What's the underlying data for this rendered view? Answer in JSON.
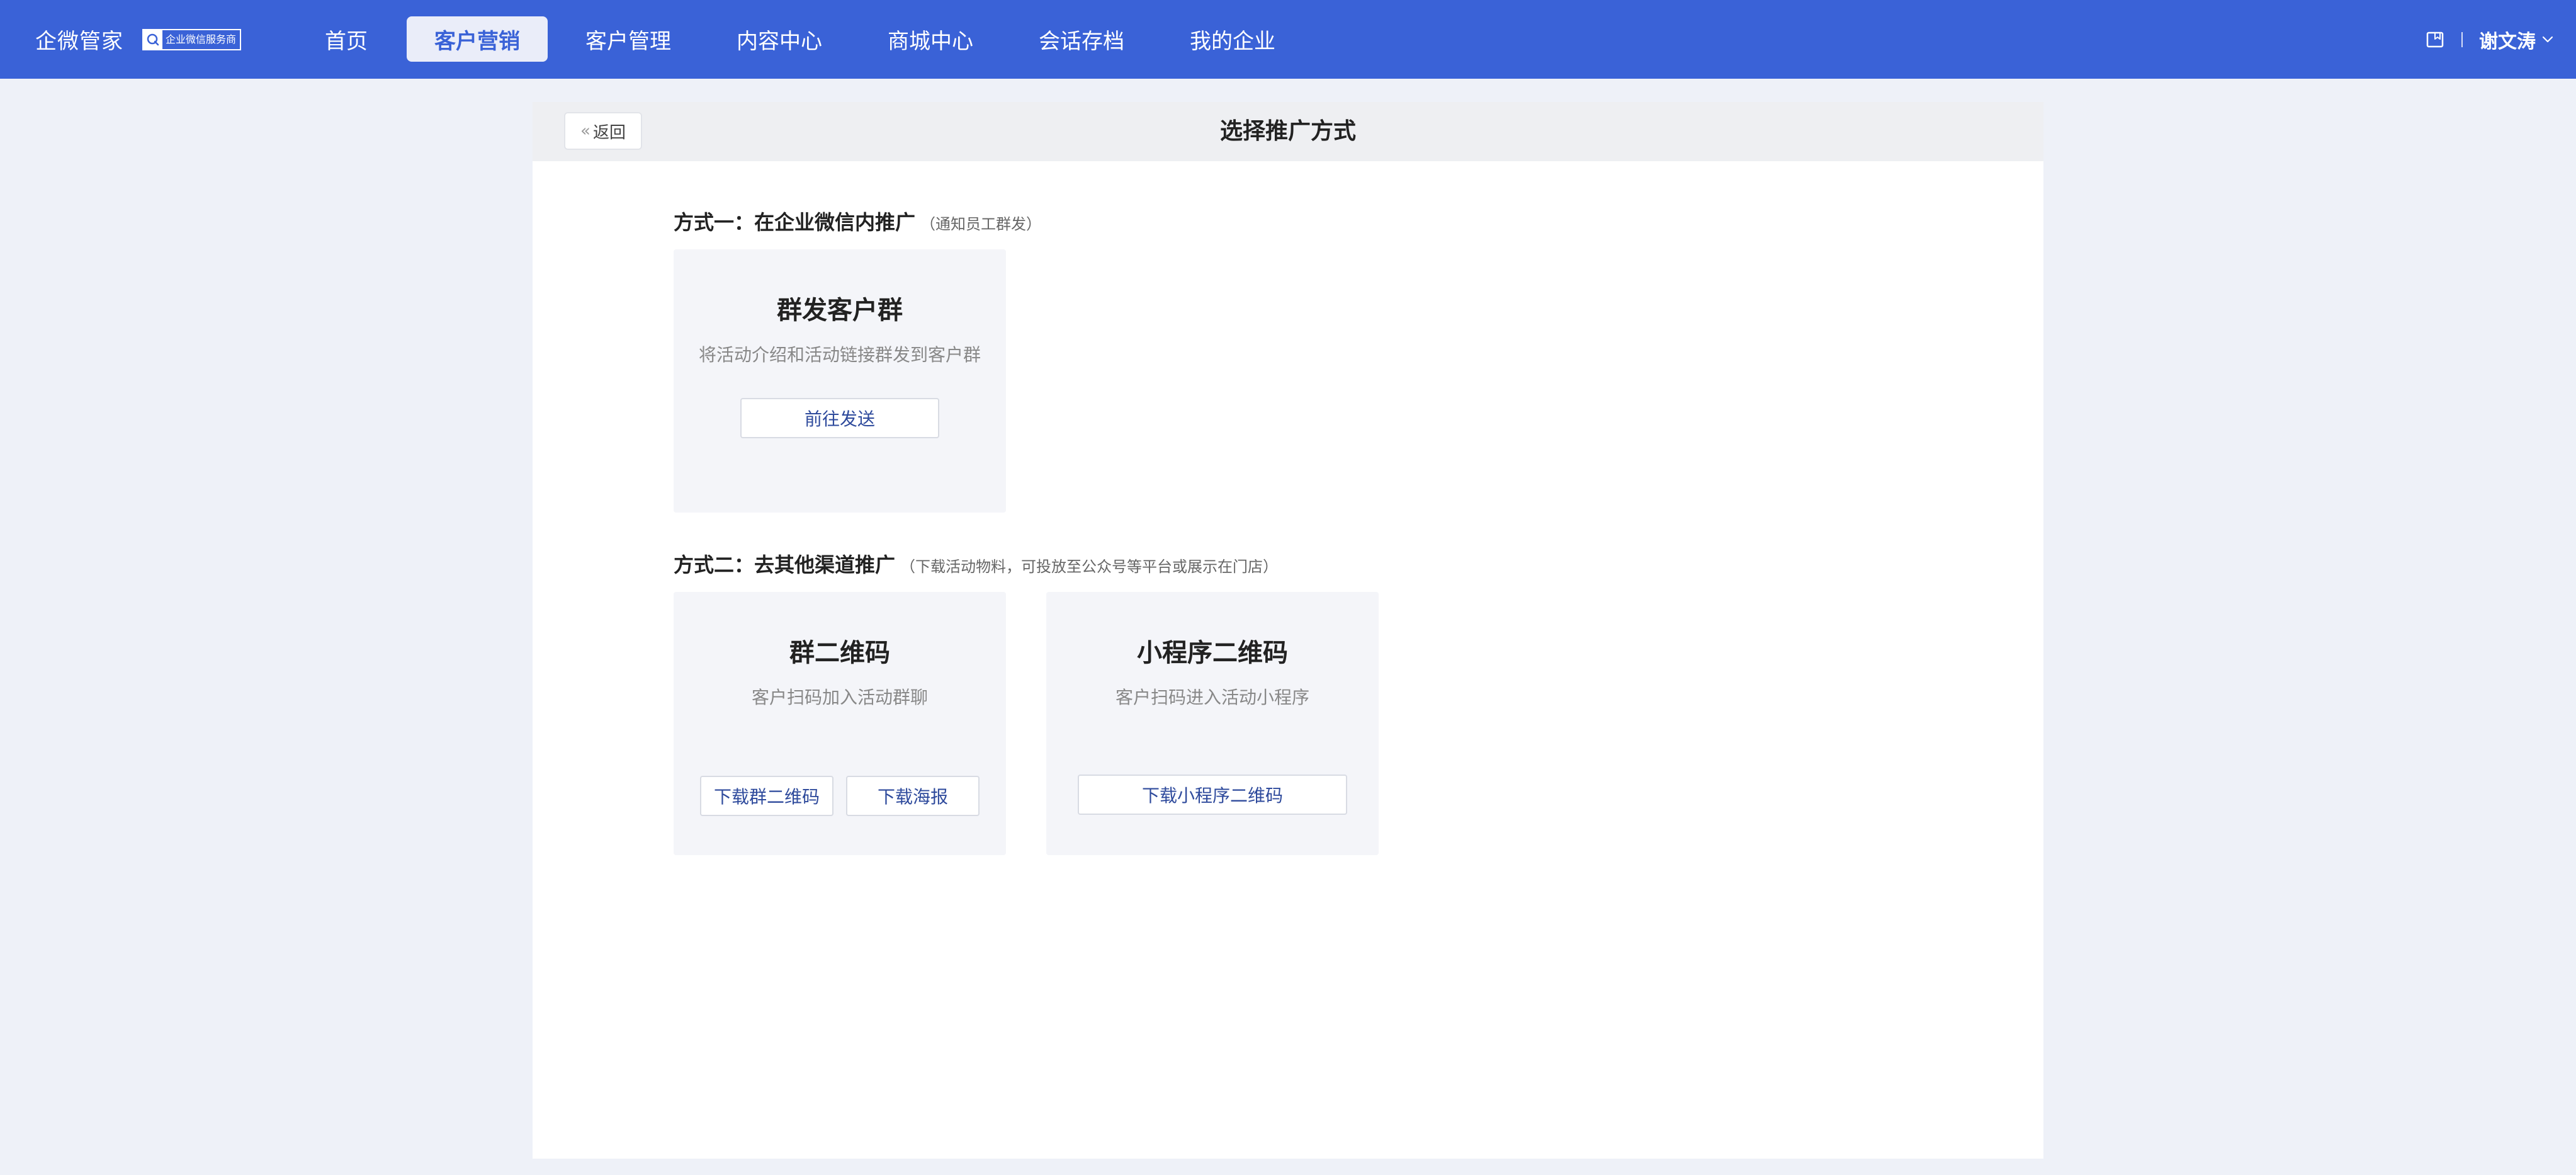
{
  "header": {
    "brand_name": "企微管家",
    "badge_text": "企业微信服务商",
    "nav": [
      {
        "label": "首页"
      },
      {
        "label": "客户营销",
        "active": true
      },
      {
        "label": "客户管理"
      },
      {
        "label": "内容中心"
      },
      {
        "label": "商城中心"
      },
      {
        "label": "会话存档"
      },
      {
        "label": "我的企业"
      }
    ],
    "user_name": "谢文涛",
    "icons": {
      "guide": "book-icon",
      "user_menu": "chevron-down-icon"
    }
  },
  "page": {
    "back_label": "返回",
    "title": "选择推广方式"
  },
  "sections": [
    {
      "title": "方式一：在企业微信内推广",
      "note": "（通知员工群发）",
      "cards": [
        {
          "title": "群发客户群",
          "desc": "将活动介绍和活动链接群发到客户群",
          "buttons": [
            "前往发送"
          ]
        }
      ]
    },
    {
      "title": "方式二：去其他渠道推广",
      "note": "（下载活动物料，可投放至公众号等平台或展示在门店）",
      "cards": [
        {
          "title": "群二维码",
          "desc": "客户扫码加入活动群聊",
          "buttons": [
            "下载群二维码",
            "下载海报"
          ]
        },
        {
          "title": "小程序二维码",
          "desc": "客户扫码进入活动小程序",
          "buttons": [
            "下载小程序二维码"
          ]
        }
      ]
    }
  ],
  "colors": {
    "topbar": "#3a62d7",
    "page_background": "#eef1f8",
    "card_background": "#f4f5f9",
    "button_text": "#2e4a9c"
  }
}
